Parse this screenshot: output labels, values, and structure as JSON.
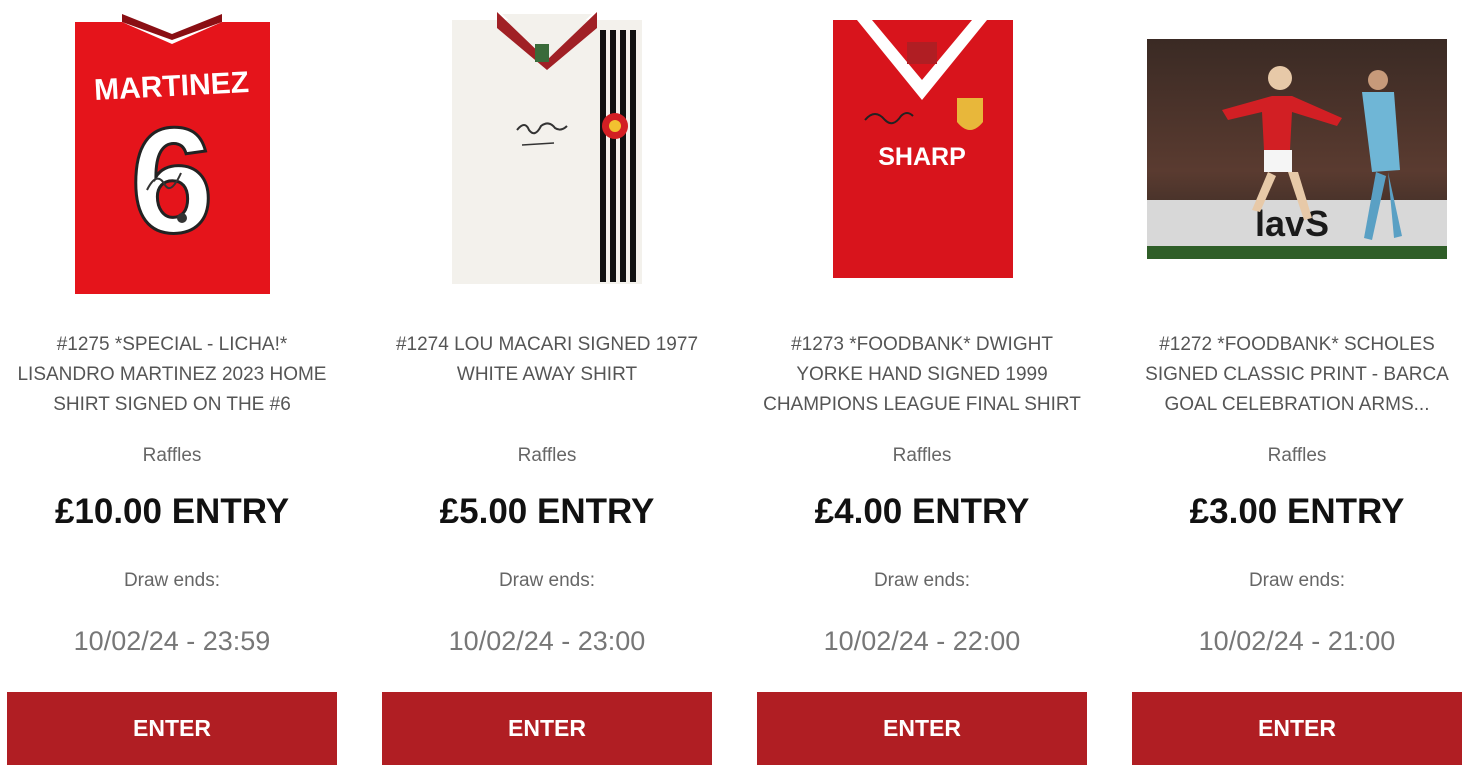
{
  "items": [
    {
      "title": "#1275 *SPECIAL - LICHA!* LISANDRO MARTINEZ 2023 HOME SHIRT SIGNED ON THE #6",
      "category": "Raffles",
      "price": "£10.00 ENTRY",
      "draw_label": "Draw ends:",
      "draw_date": "10/02/24 - 23:59",
      "button_label": "ENTER",
      "image": {
        "icon": "red-home-shirt-martinez-6",
        "name_print": "MARTINEZ",
        "number_print": "6"
      }
    },
    {
      "title": "#1274 LOU MACARI SIGNED 1977 WHITE AWAY SHIRT",
      "category": "Raffles",
      "price": "£5.00 ENTRY",
      "draw_label": "Draw ends:",
      "draw_date": "10/02/24 - 23:00",
      "button_label": "ENTER",
      "image": {
        "icon": "white-away-shirt-black-stripes"
      }
    },
    {
      "title": "#1273 *FOODBANK* DWIGHT YORKE HAND SIGNED 1999 CHAMPIONS LEAGUE FINAL SHIRT",
      "category": "Raffles",
      "price": "£4.00 ENTRY",
      "draw_label": "Draw ends:",
      "draw_date": "10/02/24 - 22:00",
      "button_label": "ENTER",
      "image": {
        "icon": "red-shirt-sharp-sponsor",
        "sponsor_print": "SHARP"
      }
    },
    {
      "title": "#1272 *FOODBANK* SCHOLES SIGNED CLASSIC PRINT - BARCA GOAL CELEBRATION ARMS...",
      "category": "Raffles",
      "price": "£3.00 ENTRY",
      "draw_label": "Draw ends:",
      "draw_date": "10/02/24 - 21:00",
      "button_label": "ENTER",
      "image": {
        "icon": "goal-celebration-photo"
      }
    }
  ],
  "colors": {
    "button": "#b01e23",
    "shirt_red": "#e5141b",
    "text_dark": "#111111",
    "text_muted": "#666666"
  }
}
